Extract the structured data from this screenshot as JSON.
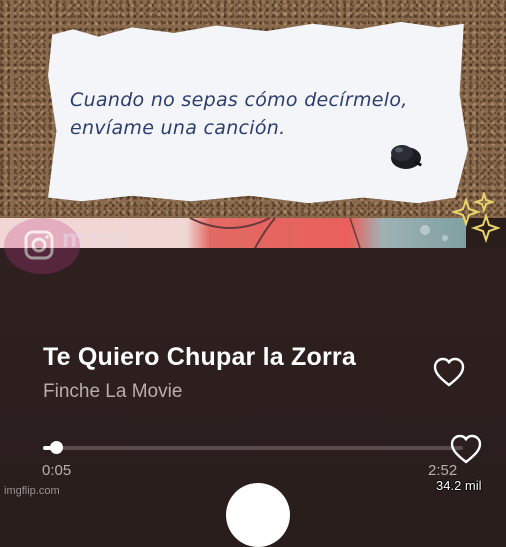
{
  "note": {
    "line1": "Cuando no sepas cómo decírmelo,",
    "line2": "envíame una canción."
  },
  "overlay": {
    "handle": "moni"
  },
  "player": {
    "track_title": "Te Quiero Chupar la Zorra",
    "artist": "Finche La Movie",
    "current_time": "0:05",
    "total_time": "2:52",
    "progress": 0.03,
    "likes_count": "34.2 mil"
  },
  "watermark": "imgflip.com",
  "icons": {
    "like": "heart-icon",
    "pin": "pushpin-icon",
    "sparkles": "sparkles-icon",
    "play": "play-button"
  },
  "colors": {
    "background": "#2a1e1d",
    "title": "#ffffff",
    "secondary": "#b8aeac",
    "note_ink": "#2c3e6b"
  }
}
